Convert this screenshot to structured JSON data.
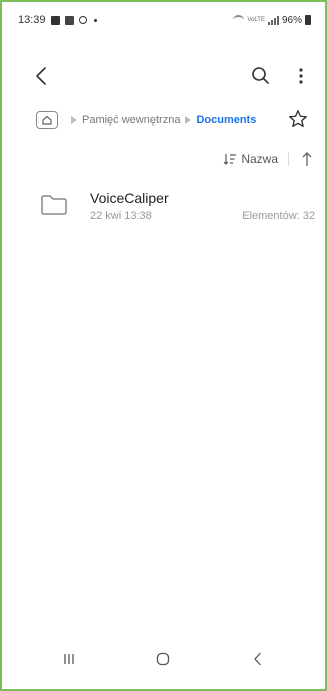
{
  "status_bar": {
    "time": "13:39",
    "battery": "96%",
    "network": "VoLTE",
    "icons": [
      "image-icon",
      "sim-icon",
      "at-icon",
      "dot-icon",
      "wifi-icon",
      "signal-icon",
      "battery-icon"
    ]
  },
  "toolbar": {
    "back_icon": "chevron-left-icon",
    "search_icon": "search-icon",
    "more_icon": "more-vertical-icon"
  },
  "breadcrumb": {
    "home_icon": "home-folder-icon",
    "items": [
      "Pamięć wewnętrzna",
      "Documents"
    ],
    "favorite_icon": "star-outline-icon"
  },
  "sort": {
    "label": "Nazwa",
    "icon": "sort-icon",
    "direction_icon": "arrow-up-icon"
  },
  "files": [
    {
      "name": "VoiceCaliper",
      "date": "22 kwi 13:38",
      "count": "Elementów: 32",
      "icon": "folder-icon"
    }
  ],
  "navbar": {
    "icons": [
      "recents-icon",
      "home-icon",
      "back-icon"
    ]
  },
  "colors": {
    "accent": "#1a73e8",
    "frame": "#7cbf5a"
  }
}
